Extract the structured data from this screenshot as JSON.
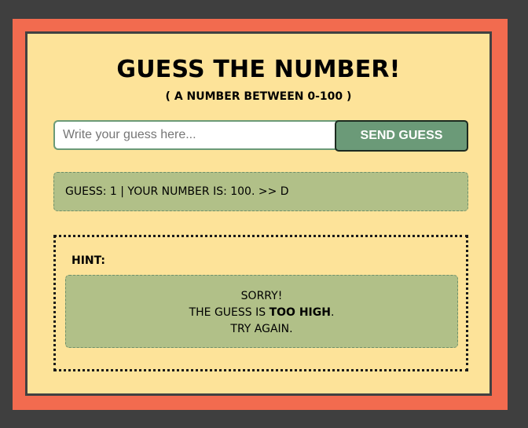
{
  "header": {
    "title": "GUESS THE NUMBER!",
    "subtitle": "( A NUMBER BETWEEN 0-100 )"
  },
  "form": {
    "input_placeholder": "Write your guess here...",
    "input_value": "",
    "send_label": "SEND GUESS"
  },
  "status": {
    "text": "GUESS: 1 | YOUR NUMBER IS: 100. >> D"
  },
  "hint": {
    "label": "HINT:",
    "line1": "SORRY!",
    "line2_prefix": "THE GUESS IS ",
    "line2_bold": "TOO HIGH",
    "line2_suffix": ".",
    "line3": "TRY AGAIN."
  },
  "colors": {
    "page_background": "#3f3f3f",
    "frame": "#f26b4f",
    "card_background": "#fde399",
    "accent_green": "#6b9a78",
    "message_background": "#b1c088"
  }
}
